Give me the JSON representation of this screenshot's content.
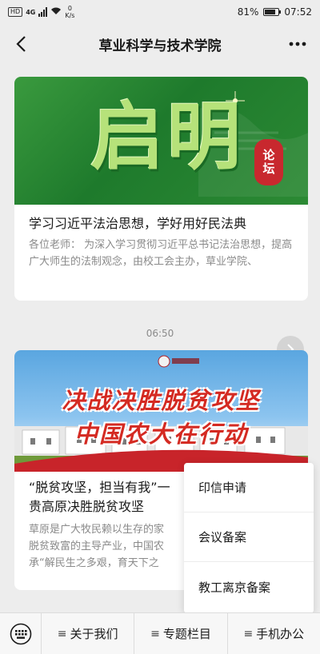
{
  "status_bar": {
    "network_badge": "HD",
    "network_type": "4G",
    "speed_value": "0",
    "speed_unit": "K/s",
    "battery": "81%",
    "battery_level": 0.81,
    "time": "07:52"
  },
  "nav": {
    "title": "草业科学与技术学院",
    "back_icon": "back-arrow-icon",
    "more_icon": "more-dots-icon"
  },
  "articles": [
    {
      "banner_main_text": "启明",
      "banner_badge": "论坛",
      "title": "学习习近平法治思想，学好用好民法典",
      "desc": "各位老师：        为深入学习贯彻习近平总书记法治思想，提高广大师生的法制观念，由校工会主办，草业学院、"
    },
    {
      "banner_line1": "决战决胜脱贫攻坚",
      "banner_line2": "中国农大在行动",
      "title_line1": "“脱贫攻坚，担当有我”一",
      "title_line2": "贵高原决胜脱贫攻坚",
      "desc_line1": "草原是广大牧民赖以生存的家",
      "desc_line2": "脱贫致富的主导产业，中国农",
      "desc_line3": "承“解民生之多艰，育天下之"
    }
  ],
  "time_separator": "06:50",
  "popup_menu": {
    "items": [
      "印信申请",
      "会议备案",
      "教工离京备案"
    ]
  },
  "bottom_menu": {
    "keyboard_icon": "keyboard-icon",
    "tabs": [
      "关于我们",
      "专题栏目",
      "手机办公"
    ]
  },
  "colors": {
    "green_banner": "#2c8a34",
    "badge_red": "#c8282e",
    "background": "#ededed"
  }
}
